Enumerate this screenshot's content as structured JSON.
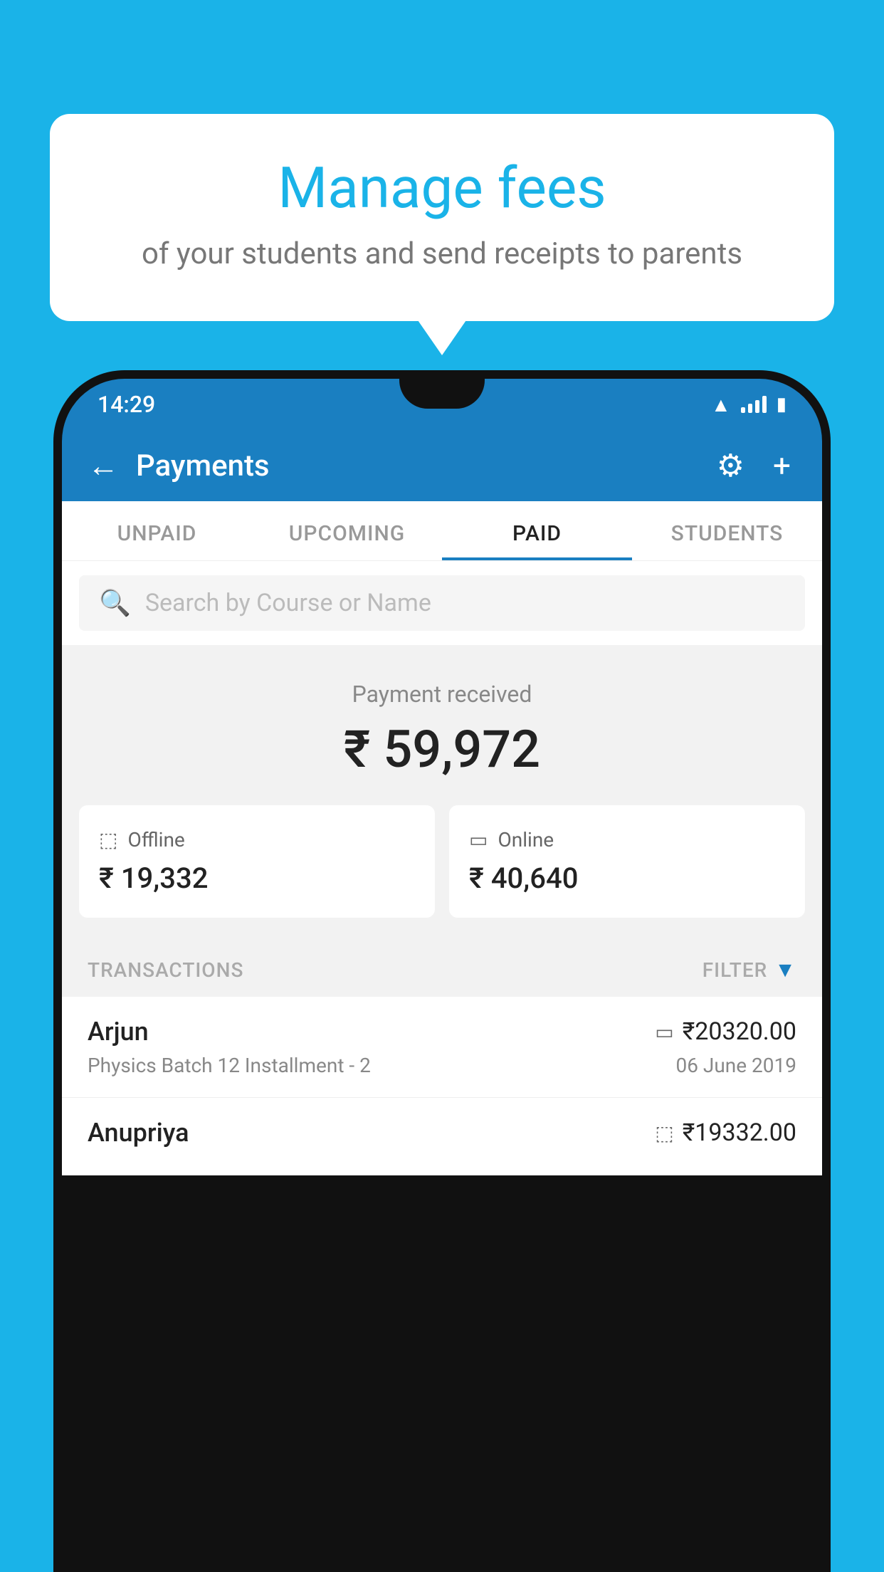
{
  "background_color": "#1ab3e8",
  "speech_bubble": {
    "title": "Manage fees",
    "subtitle": "of your students and send receipts to parents"
  },
  "status_bar": {
    "time": "14:29",
    "wifi": "wifi",
    "signal": "signal",
    "battery": "battery"
  },
  "app_bar": {
    "title": "Payments",
    "back_label": "←",
    "gear_label": "⚙",
    "plus_label": "+"
  },
  "tabs": [
    {
      "label": "UNPAID",
      "active": false
    },
    {
      "label": "UPCOMING",
      "active": false
    },
    {
      "label": "PAID",
      "active": true
    },
    {
      "label": "STUDENTS",
      "active": false
    }
  ],
  "search": {
    "placeholder": "Search by Course or Name"
  },
  "payment_summary": {
    "label": "Payment received",
    "amount": "₹ 59,972"
  },
  "payment_cards": [
    {
      "type": "Offline",
      "amount": "₹ 19,332",
      "icon": "offline"
    },
    {
      "type": "Online",
      "amount": "₹ 40,640",
      "icon": "online"
    }
  ],
  "transactions_section": {
    "label": "TRANSACTIONS",
    "filter_label": "FILTER"
  },
  "transactions": [
    {
      "name": "Arjun",
      "course": "Physics Batch 12 Installment - 2",
      "amount": "₹20320.00",
      "date": "06 June 2019",
      "payment_type": "online"
    },
    {
      "name": "Anupriya",
      "course": "",
      "amount": "₹19332.00",
      "date": "",
      "payment_type": "offline"
    }
  ]
}
